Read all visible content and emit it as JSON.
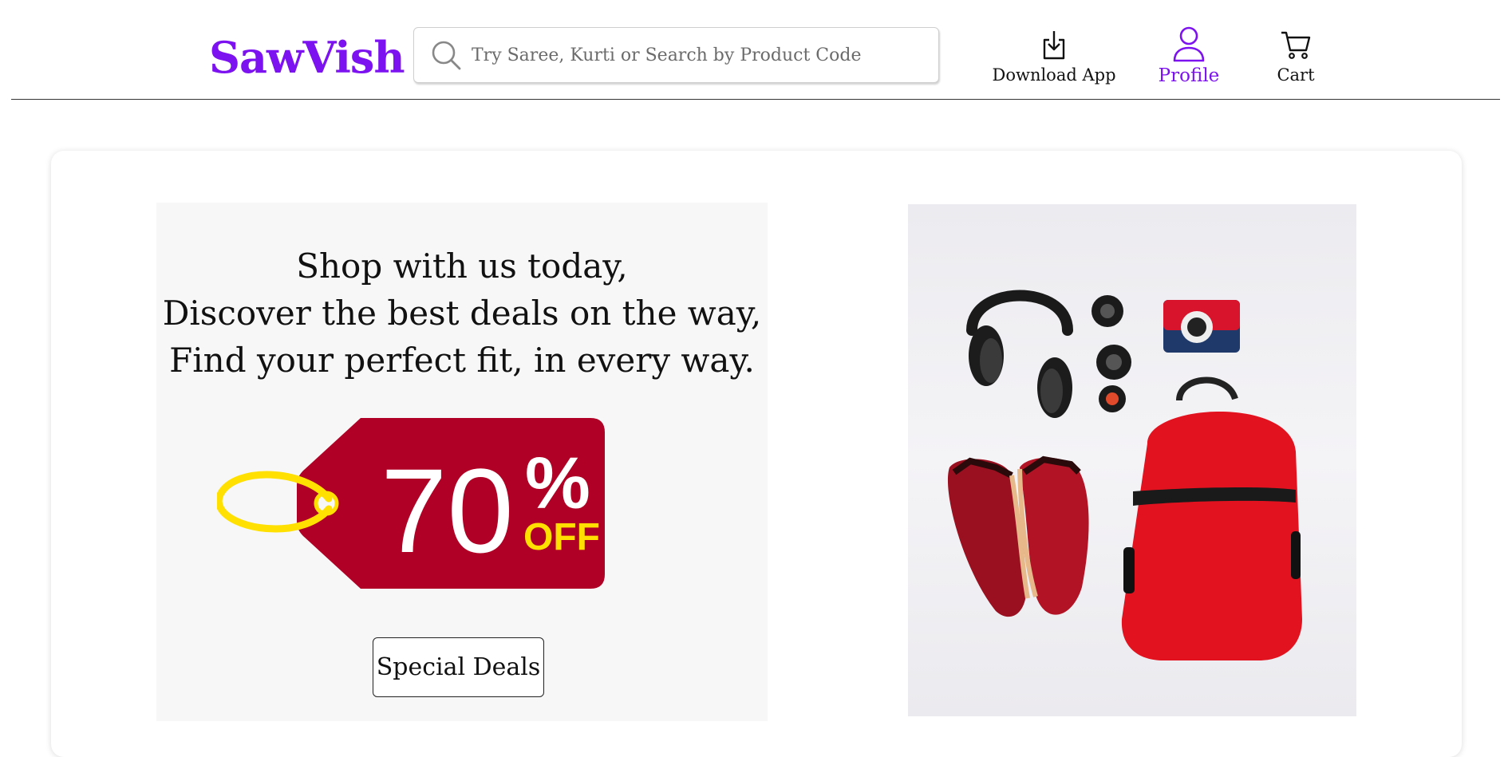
{
  "header": {
    "logo": "SawVish",
    "search": {
      "placeholder": "Try Saree, Kurti or Search by Product Code",
      "value": ""
    },
    "nav": {
      "download_label": "Download App",
      "profile_label": "Profile",
      "cart_label": "Cart"
    }
  },
  "hero": {
    "lines": [
      "Shop with us today,",
      "Discover the best deals on the way,",
      "Find your perfect fit, in every way."
    ],
    "tag": {
      "number": "70",
      "percent": "%",
      "off": "OFF"
    },
    "cta_label": "Special Deals"
  },
  "colors": {
    "brand": "#7c12f0",
    "tag_red": "#b10026",
    "tag_yellow": "#ffe000"
  },
  "icons": [
    "search-icon",
    "download-icon",
    "user-icon",
    "cart-icon"
  ]
}
